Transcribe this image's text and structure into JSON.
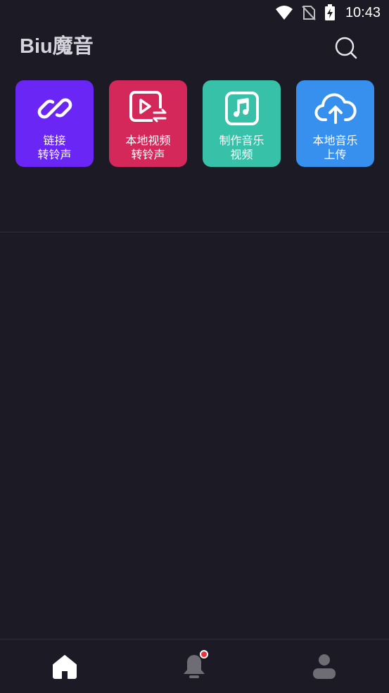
{
  "status_bar": {
    "time": "10:43",
    "icons": [
      "wifi-icon",
      "no-sim-icon",
      "battery-charging-icon"
    ]
  },
  "header": {
    "title": "Biu魔音",
    "search_icon": "search-icon"
  },
  "tiles": [
    {
      "line1": "链接",
      "line2": "转铃声",
      "color": "#6a26f5",
      "icon": "link-icon"
    },
    {
      "line1": "本地视频",
      "line2": "转铃声",
      "color": "#d5285a",
      "icon": "video-convert-icon"
    },
    {
      "line1": "制作音乐",
      "line2": "视频",
      "color": "#36c1a8",
      "icon": "music-note-icon"
    },
    {
      "line1": "本地音乐",
      "line2": "上传",
      "color": "#3790ee",
      "icon": "cloud-upload-icon"
    }
  ],
  "bottom_nav": {
    "items": [
      {
        "icon": "home-icon",
        "active": true
      },
      {
        "icon": "bell-icon",
        "badge": true
      },
      {
        "icon": "profile-icon"
      }
    ]
  },
  "colors": {
    "background": "#1c1a24",
    "divider": "#302d39",
    "inactive_icon": "#6e6c74",
    "active_icon": "#ffffff",
    "badge": "#e8333a"
  }
}
